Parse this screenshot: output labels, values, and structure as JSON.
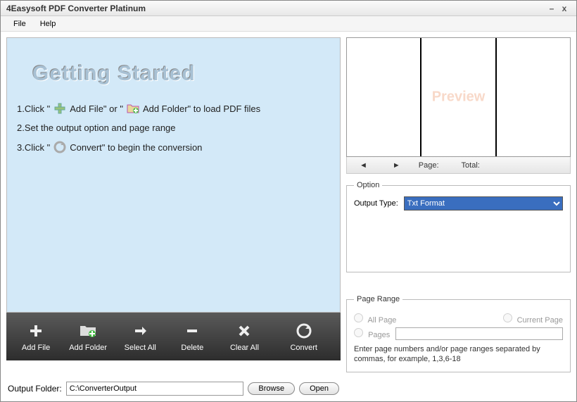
{
  "window": {
    "title": "4Easysoft PDF Converter Platinum",
    "minimize": "–",
    "close": "x"
  },
  "menu": {
    "file": "File",
    "help": "Help"
  },
  "getting_started": {
    "title": "Getting Started",
    "line1a": "1.Click \"",
    "line1b": " Add File\" or \"",
    "line1c": " Add Folder\" to load PDF files",
    "line2": "2.Set the output option and page range",
    "line3a": "3.Click \"",
    "line3b": " Convert\" to begin the conversion"
  },
  "toolbar": {
    "add_file": "Add File",
    "add_folder": "Add Folder",
    "select_all": "Select All",
    "delete": "Delete",
    "clear_all": "Clear All",
    "convert": "Convert"
  },
  "output": {
    "label": "Output Folder:",
    "path": "C:\\ConverterOutput",
    "browse": "Browse",
    "open": "Open"
  },
  "preview": {
    "label": "Preview"
  },
  "pager": {
    "page_label": "Page:",
    "page_value": "",
    "total_label": "Total:",
    "total_value": ""
  },
  "option": {
    "legend": "Option",
    "output_type_label": "Output Type:",
    "output_type_value": "Txt Format"
  },
  "page_range": {
    "legend": "Page Range",
    "all_page": "All Page",
    "current_page": "Current Page",
    "pages": "Pages",
    "pages_value": "",
    "hint": "Enter page numbers and/or page ranges separated by commas, for example, 1,3,6-18"
  }
}
